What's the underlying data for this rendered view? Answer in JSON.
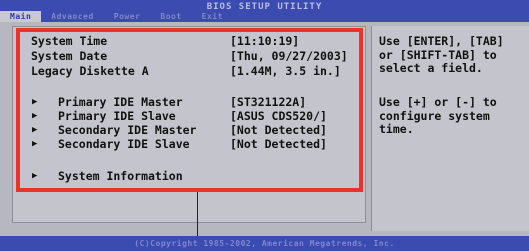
{
  "header": {
    "title": "BIOS SETUP UTILITY",
    "tabs": [
      {
        "label": "Main",
        "active": true
      },
      {
        "label": "Advanced",
        "active": false
      },
      {
        "label": "Power",
        "active": false
      },
      {
        "label": "Boot",
        "active": false
      },
      {
        "label": "Exit",
        "active": false
      }
    ]
  },
  "main": {
    "settings": [
      {
        "label": "System Time",
        "value": "[11:10:19]"
      },
      {
        "label": "System Date",
        "value": "[Thu, 09/27/2003]"
      },
      {
        "label": "Legacy Diskette A",
        "value": "[1.44M, 3.5 in.]"
      }
    ],
    "submenus": [
      {
        "label": "Primary IDE Master",
        "value": "[ST321122A]"
      },
      {
        "label": "Primary IDE Slave",
        "value": "[ASUS CDS520/]"
      },
      {
        "label": "Secondary IDE Master",
        "value": "[Not Detected]"
      },
      {
        "label": "Secondary IDE Slave",
        "value": "[Not Detected]"
      }
    ],
    "system_info": {
      "label": "System Information"
    }
  },
  "help": {
    "para1": "Use [ENTER], [TAB]\nor [SHIFT-TAB] to\nselect a field.",
    "para2": "Use [+] or [-] to\nconfigure system\ntime."
  },
  "footer": {
    "copyright": "(C)Copyright 1985-2002, American Megatrends, Inc."
  },
  "colors": {
    "header_blue": "#3c4bb0",
    "panel_gray": "#c4c4cc",
    "highlight_red": "#e8322c"
  }
}
